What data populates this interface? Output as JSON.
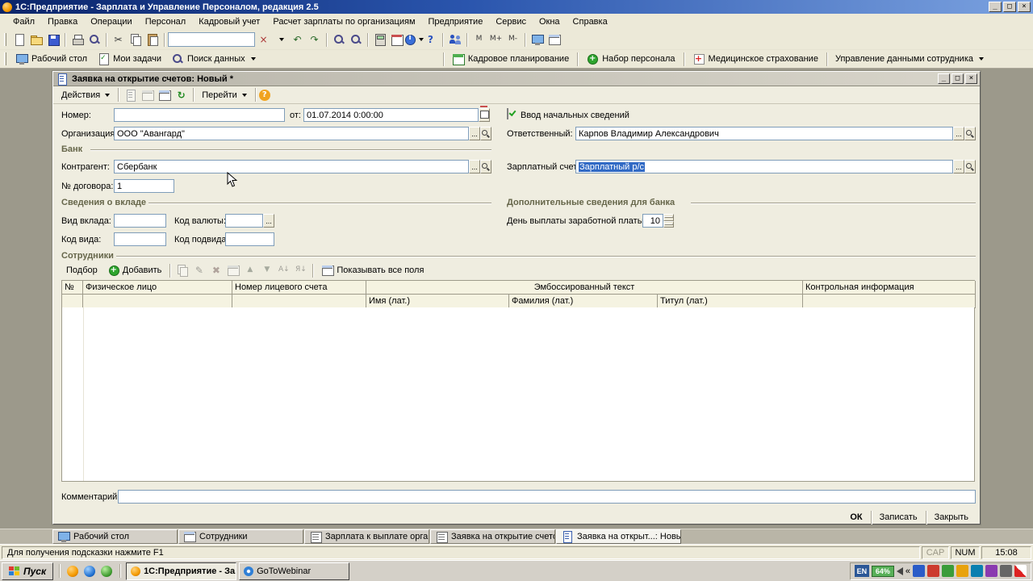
{
  "titlebar": {
    "title": "1С:Предприятие - Зарплата и Управление Персоналом, редакция 2.5"
  },
  "window_controls": {
    "minimize": "_",
    "maximize": "□",
    "close": "×"
  },
  "menubar": {
    "items": [
      "Файл",
      "Правка",
      "Операции",
      "Персонал",
      "Кадровый учет",
      "Расчет зарплаты по организациям",
      "Предприятие",
      "Сервис",
      "Окна",
      "Справка"
    ]
  },
  "toolbar_search": {
    "value": ""
  },
  "calc_buttons": {
    "m": "М",
    "m_plus": "М+",
    "m_minus": "М-"
  },
  "toolbar_nav": {
    "desktop": "Рабочий стол",
    "tasks": "Мои задачи",
    "search": "Поиск данных",
    "hr_planning": "Кадровое планирование",
    "recruitment": "Набор персонала",
    "insurance": "Медицинское страхование",
    "employee_data": "Управление данными сотрудника"
  },
  "doc": {
    "title": "Заявка на открытие счетов: Новый *",
    "actions": "Действия",
    "goto": "Перейти",
    "number_label": "Номер:",
    "number_value": "",
    "date_label": "от:",
    "date_value": "01.07.2014 0:00:00",
    "init_checkbox_label": "Ввод начальных сведений",
    "org_label": "Организация:",
    "org_value": "ООО \"Авангард\"",
    "responsible_label": "Ответственный:",
    "responsible_value": "Карпов Владимир Александрович",
    "section_bank": "Банк",
    "contragent_label": "Контрагент:",
    "contragent_value": "Сбербанк",
    "salary_account_label": "Зарплатный счет:",
    "salary_account_value": "Зарплатный р/с",
    "contract_label": "№ договора:",
    "contract_value": "1",
    "section_deposit": "Сведения о вкладе",
    "deposit_kind_label": "Вид вклада:",
    "deposit_kind_value": "",
    "currency_code_label": "Код валюты:",
    "currency_code_value": "",
    "kind_code_label": "Код вида:",
    "kind_code_value": "",
    "subkind_code_label": "Код подвида:",
    "subkind_code_value": "",
    "section_bank_extra": "Дополнительные сведения для банка",
    "payday_label": "День выплаты заработной платы:",
    "payday_value": "10",
    "section_employees": "Сотрудники",
    "emp_pick": "Подбор",
    "emp_add": "Добавить",
    "emp_show_all": "Показывать все поля",
    "comment_label": "Комментарий:",
    "comment_value": "",
    "btn_ok": "ОК",
    "btn_save": "Записать",
    "btn_close": "Закрыть",
    "table": {
      "num": "№",
      "person": "Физическое лицо",
      "account": "Номер лицевого счета",
      "emboss": "Эмбоссированный текст",
      "name": "Имя (лат.)",
      "surname": "Фамилия (лат.)",
      "title": "Титул (лат.)",
      "control": "Контрольная информация"
    }
  },
  "mdi_tabs": [
    {
      "label": "Рабочий стол"
    },
    {
      "label": "Сотрудники"
    },
    {
      "label": "Зарплата к выплате органи..."
    },
    {
      "label": "Заявка на открытие счетов"
    },
    {
      "label": "Заявка на открыт...: Новый *"
    }
  ],
  "statusbar": {
    "hint": "Для получения подсказки нажмите F1",
    "cap": "CAP",
    "num": "NUM",
    "time": "15:08"
  },
  "taskbar": {
    "start": "Пуск",
    "task1": "1С:Предприятие - За...",
    "task2": "GoToWebinar",
    "tray_lang": "EN",
    "tray_battery": "64%",
    "tray_collapse": "«"
  },
  "icons": {
    "cut": "✂",
    "undo": "↶",
    "redo": "↷",
    "refresh": "↻",
    "pencil": "✎",
    "delete": "✖",
    "move_up": "▲",
    "move_down": "▼",
    "sort_asc": "А↓",
    "sort_desc": "Я↓",
    "dots": "...",
    "help": "?"
  }
}
